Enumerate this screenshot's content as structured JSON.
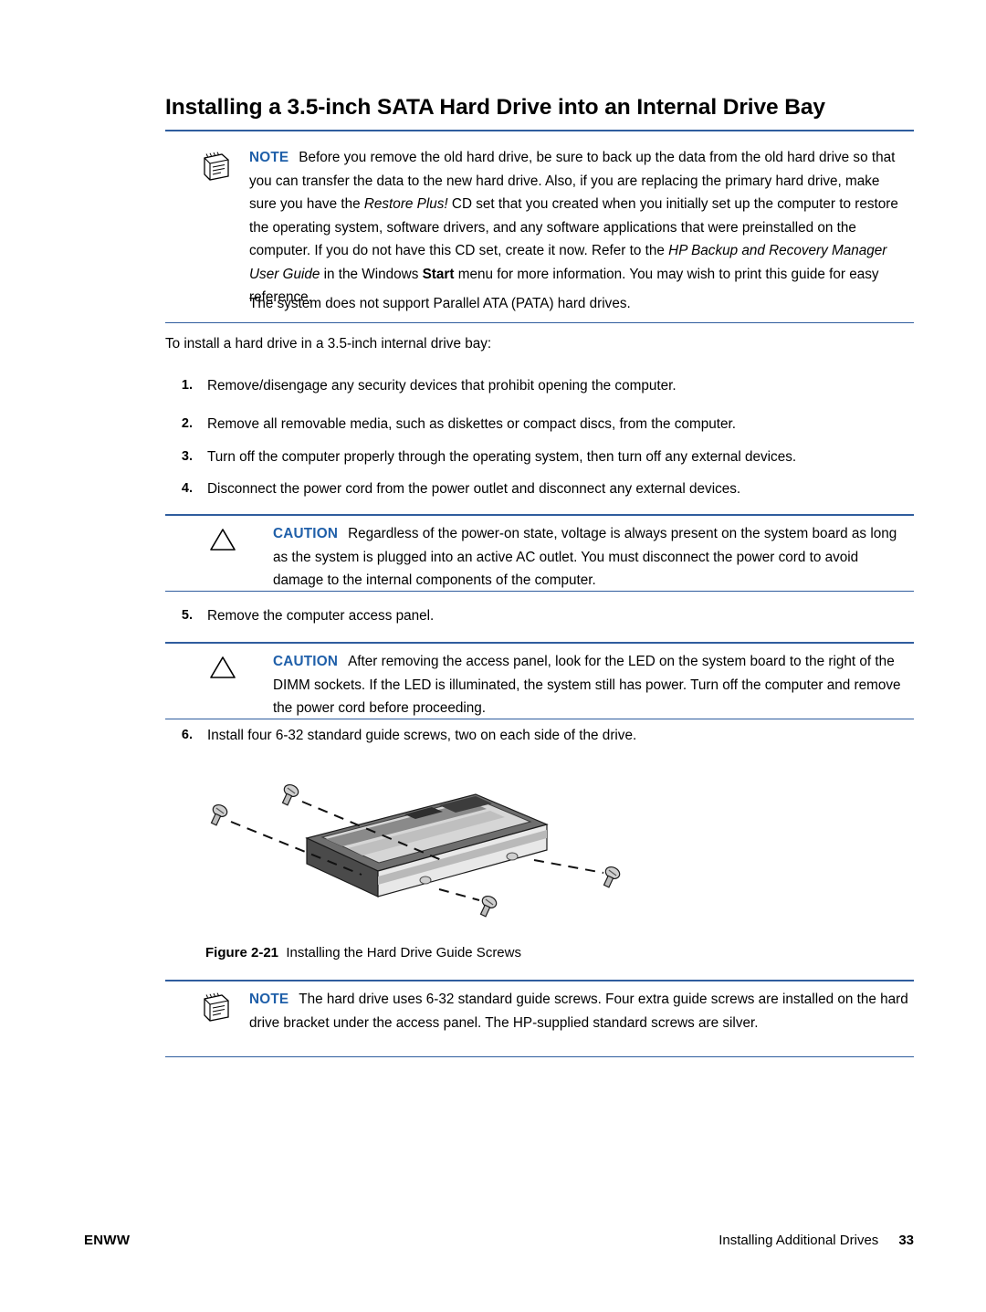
{
  "page": {
    "title": "Installing a 3.5-inch SATA Hard Drive into an Internal Drive Bay",
    "intro": "To install a hard drive in a 3.5-inch internal drive bay:"
  },
  "note1": {
    "label": "NOTE",
    "text_part1": "Before you remove the old hard drive, be sure to back up the data from the old hard drive so that you can transfer the data to the new hard drive. Also, if you are replacing the primary hard drive, make sure you have the ",
    "italic1": "Restore Plus!",
    "text_part2": " CD set that you created when you initially set up the computer to restore the operating system, software drivers, and any software applications that were preinstalled on the computer. If you do not have this CD set, create it now. Refer to the ",
    "italic2": "HP Backup and Recovery Manager User Guide",
    "text_part3": " in the Windows ",
    "bold1": "Start",
    "text_part4": " menu for more information. You may wish to print this guide for easy reference.",
    "extra": "The system does not support Parallel ATA (PATA) hard drives."
  },
  "steps": [
    {
      "num": "1.",
      "text": "Remove/disengage any security devices that prohibit opening the computer."
    },
    {
      "num": "2.",
      "text": "Remove all removable media, such as diskettes or compact discs, from the computer."
    },
    {
      "num": "3.",
      "text": "Turn off the computer properly through the operating system, then turn off any external devices."
    },
    {
      "num": "4.",
      "text": "Disconnect the power cord from the power outlet and disconnect any external devices."
    },
    {
      "num": "5.",
      "text": "Remove the computer access panel."
    },
    {
      "num": "6.",
      "text": "Install four 6-32 standard guide screws, two on each side of the drive."
    }
  ],
  "caution1": {
    "label": "CAUTION",
    "text": "Regardless of the power-on state, voltage is always present on the system board as long as the system is plugged into an active AC outlet. You must disconnect the power cord to avoid damage to the internal components of the computer."
  },
  "caution2": {
    "label": "CAUTION",
    "text": "After removing the access panel, look for the LED on the system board to the right of the DIMM sockets. If the LED is illuminated, the system still has power. Turn off the computer and remove the power cord before proceeding."
  },
  "figure": {
    "label": "Figure 2-21",
    "caption": "Installing the Hard Drive Guide Screws"
  },
  "note2": {
    "label": "NOTE",
    "text": "The hard drive uses 6-32 standard guide screws. Four extra guide screws are installed on the hard drive bracket under the access panel. The HP-supplied standard screws are silver."
  },
  "footer": {
    "left": "ENWW",
    "right": "Installing Additional Drives",
    "page_number": "33"
  },
  "colors": {
    "rule": "#2f5d9e",
    "label": "#1f5fa9"
  }
}
